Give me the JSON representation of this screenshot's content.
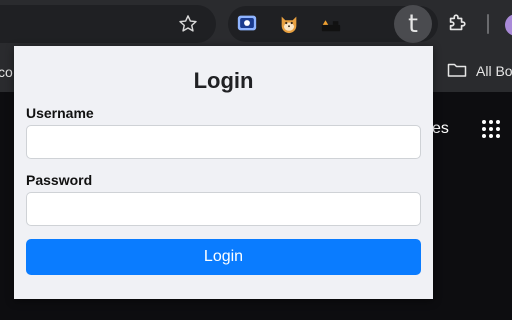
{
  "toolbar": {
    "icons": [
      "star-icon",
      "screenshot-extension-icon",
      "shiba-extension-icon",
      "dark-extension-icon",
      "t-extension-icon",
      "extensions-puzzle-icon"
    ],
    "t_extension_letter": "t"
  },
  "bookmarks": {
    "left_partial": "co",
    "all_bookmarks": "All Bo"
  },
  "page_behind": {
    "partial_text": "es"
  },
  "popup": {
    "title": "Login",
    "username_label": "Username",
    "username_value": "",
    "password_label": "Password",
    "password_value": "",
    "submit_label": "Login"
  },
  "colors": {
    "toolbar_bg": "#2a2b2e",
    "popup_bg": "#f0f1f5",
    "button_primary": "#0a7cff"
  }
}
